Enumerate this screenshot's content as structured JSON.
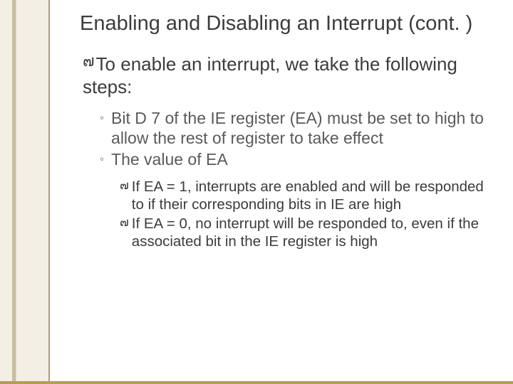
{
  "title": "Enabling and Disabling an Interrupt (cont. )",
  "bullets": {
    "lvl1": "To enable an interrupt, we take the following steps:",
    "lvl2": [
      "Bit D 7 of the IE register (EA) must be set to high to allow the rest of register to take effect",
      "The value of EA"
    ],
    "lvl3": [
      "If EA = 1, interrupts are enabled and will be responded to if their corresponding bits in IE are high",
      "If EA = 0, no interrupt will be responded to, even if the associated bit in the IE register is high"
    ]
  },
  "glyphs": {
    "script": "๗",
    "ring": "◦"
  }
}
